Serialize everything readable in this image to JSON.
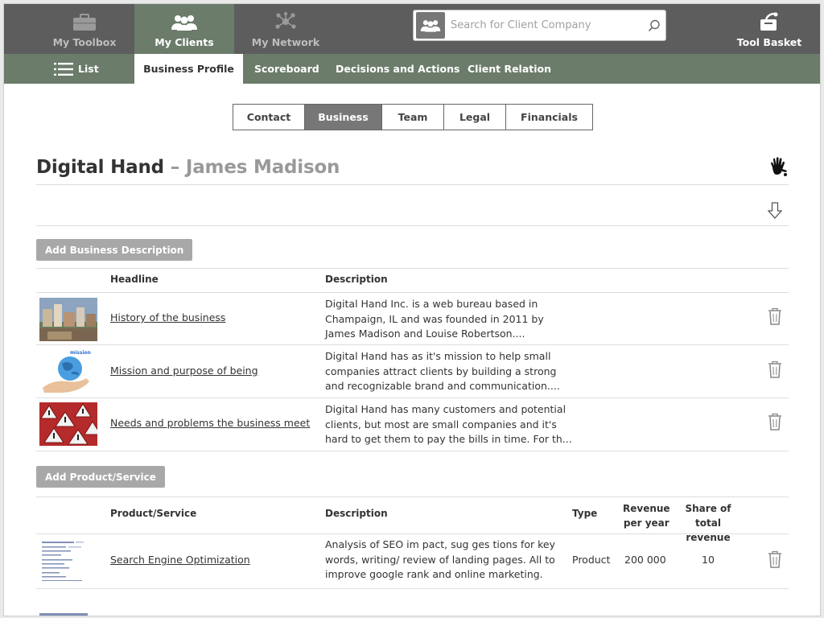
{
  "topnav": {
    "toolbox": "My Toolbox",
    "clients": "My Clients",
    "network": "My Network",
    "basket": "Tool Basket"
  },
  "search": {
    "placeholder": "Search for Client Company"
  },
  "subnav": {
    "list": "List",
    "items": [
      "Business Profile",
      "Scoreboard",
      "Decisions and Actions",
      "Client Relation"
    ],
    "active": "Business Profile"
  },
  "tabs": {
    "items": [
      "Contact",
      "Business",
      "Team",
      "Legal",
      "Financials"
    ],
    "active": "Business"
  },
  "page": {
    "company": "Digital Hand",
    "separator": "–",
    "person": "James Madison"
  },
  "business": {
    "add_label": "Add Business Description",
    "col_headline": "Headline",
    "col_description": "Description",
    "rows": [
      {
        "headline": "History of the business",
        "desc1": "Digital Hand Inc. is a web bureau based in",
        "desc2": "Champaign, IL and was founded in 2011 by",
        "desc3": "James Madison and Louise Robertson...."
      },
      {
        "headline": "Mission and purpose of being",
        "desc1": "Digital Hand has as it's mission to help small",
        "desc2": "companies attract clients by building a strong",
        "desc3": "and recognizable brand and communication....",
        "thumb_label": "mission"
      },
      {
        "headline": "Needs and problems the business meet",
        "desc1": "Digital Hand has many customers and potential",
        "desc2": "clients, but most are small companies and it's",
        "desc3": "hard to get them to pay the bills in time. For th..."
      }
    ]
  },
  "products": {
    "add_label": "Add Product/Service",
    "col_product": "Product/Service",
    "col_description": "Description",
    "col_type": "Type",
    "col_revenue_1": "Revenue",
    "col_revenue_2": "per year",
    "col_share_1": "Share of",
    "col_share_2": "total revenue",
    "rows": [
      {
        "name": "Search Engine Optimization",
        "desc1": "Analysis of SEO im pact, sug ges tions for key",
        "desc2": "words, writing/ review of landing pages. All to",
        "desc3": "improve google rank and online marketing.",
        "type": "Product",
        "revenue": "200 000",
        "share": "10"
      }
    ]
  },
  "colors": {
    "topbar": "#5d5d5d",
    "accent": "#6b7c6a",
    "button": "#a8a8a8"
  }
}
